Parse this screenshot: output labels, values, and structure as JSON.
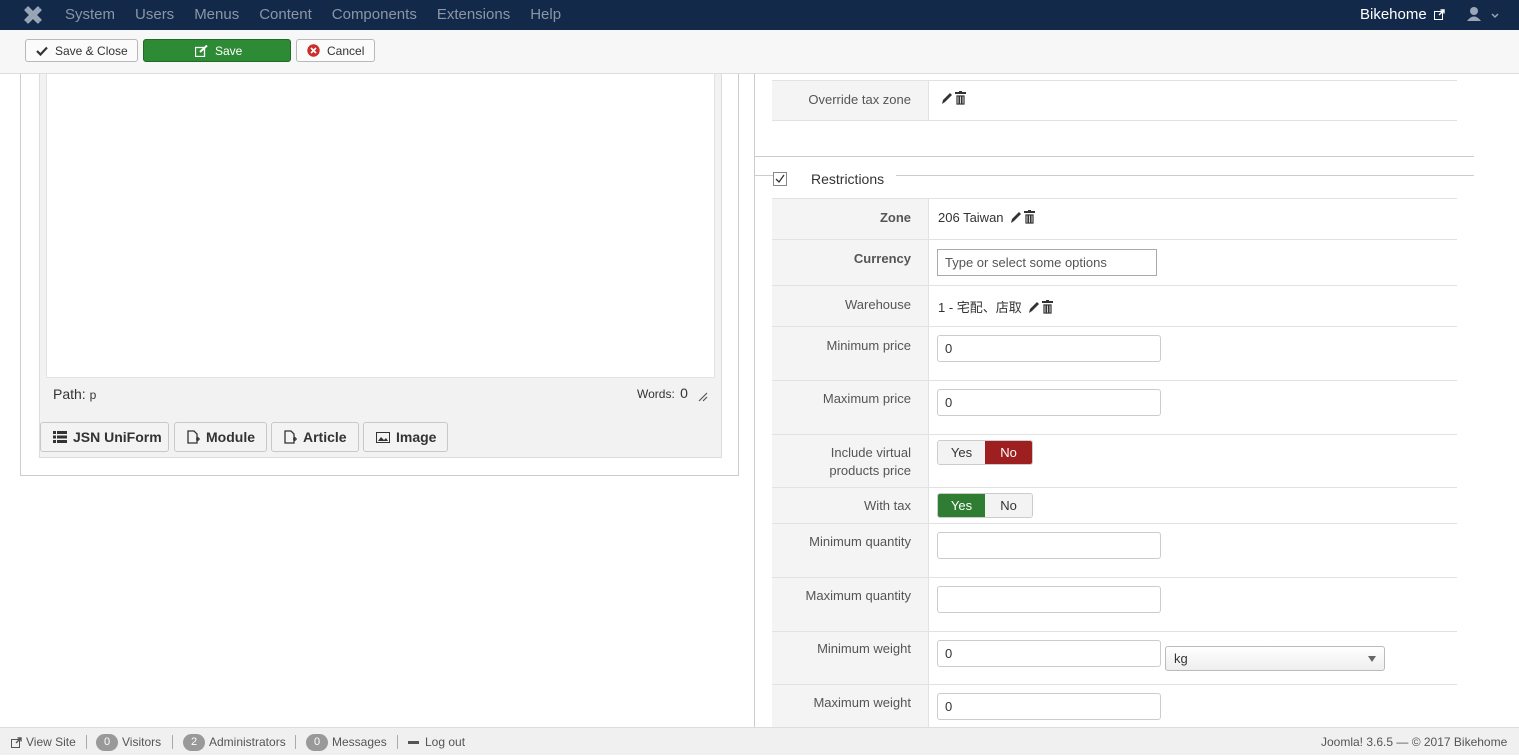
{
  "topnav": {
    "menu": [
      "System",
      "Users",
      "Menus",
      "Content",
      "Components",
      "Extensions",
      "Help"
    ],
    "site_name": "Bikehome"
  },
  "toolbar": {
    "save_close": "Save & Close",
    "save": "Save",
    "cancel": "Cancel"
  },
  "editor": {
    "path_label": "Path:",
    "path_value": "p",
    "words_label": "Words:",
    "words_count": "0",
    "buttons": [
      "JSN UniForm",
      "Module",
      "Article",
      "Image"
    ]
  },
  "tax": {
    "override_label": "Override tax zone"
  },
  "restrictions": {
    "legend": "Restrictions",
    "checked": true,
    "zone_label": "Zone",
    "zone_value": "206 Taiwan",
    "currency_label": "Currency",
    "currency_placeholder": "Type or select some options",
    "warehouse_label": "Warehouse",
    "warehouse_value": "1 - 宅配、店取",
    "min_price_label": "Minimum price",
    "min_price_value": "0",
    "max_price_label": "Maximum price",
    "max_price_value": "0",
    "include_virtual_label_1": "Include virtual",
    "include_virtual_label_2": "products price",
    "include_virtual": {
      "yes": "Yes",
      "no": "No",
      "selected": "No"
    },
    "with_tax_label": "With tax",
    "with_tax": {
      "yes": "Yes",
      "no": "No",
      "selected": "Yes"
    },
    "min_qty_label": "Minimum quantity",
    "min_qty_value": "",
    "max_qty_label": "Maximum quantity",
    "max_qty_value": "",
    "min_weight_label": "Minimum weight",
    "min_weight_value": "0",
    "weight_unit": "kg",
    "max_weight_label": "Maximum weight",
    "max_weight_value": "0"
  },
  "footer": {
    "view_site": "View Site",
    "visitors_count": "0",
    "visitors": "Visitors",
    "admins_count": "2",
    "admins": "Administrators",
    "messages_count": "0",
    "messages": "Messages",
    "logout": "Log out",
    "copyright": "Joomla! 3.6.5 — © 2017 Bikehome"
  },
  "colors": {
    "navbar": "#13294a",
    "save_green": "#2e8b35",
    "no_red": "#9e1f1f",
    "yes_green": "#2e7d32"
  }
}
